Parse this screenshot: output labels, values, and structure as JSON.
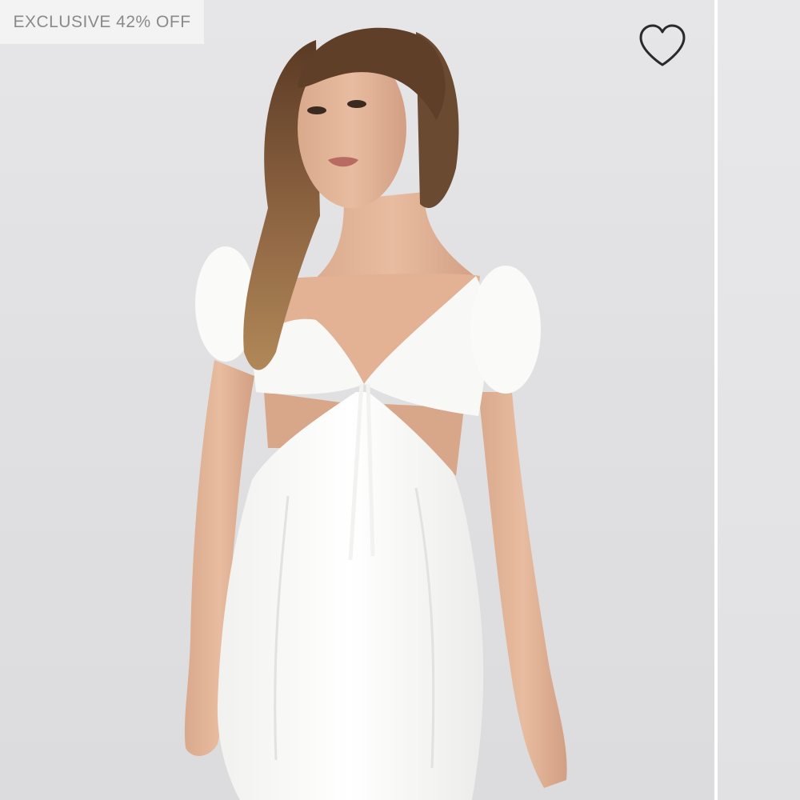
{
  "product": {
    "badge_text": "EXCLUSIVE 42% OFF",
    "wishlist_icon": "heart-outline-icon",
    "image_description_role": "product-photo"
  },
  "colors": {
    "background": "#e2e2e4",
    "badge_background": "#f3f3f3",
    "badge_text": "#8a8a8a",
    "heart_stroke": "#2a2a2a",
    "dress": "#fbfbf9"
  }
}
